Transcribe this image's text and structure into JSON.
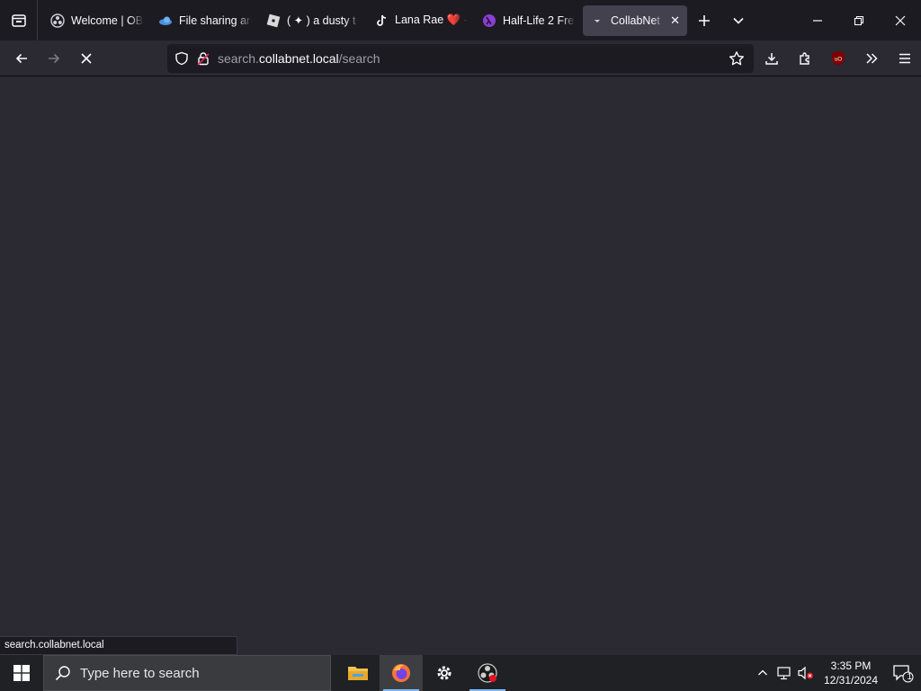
{
  "browser": {
    "tabs": [
      {
        "title": "Welcome | OB",
        "icon": "obs-icon",
        "active": false
      },
      {
        "title": "File sharing ar",
        "icon": "cloud-icon",
        "active": false
      },
      {
        "title": "( ✦ ) a dusty t",
        "icon": "roblox-icon",
        "active": false
      },
      {
        "title": "Lana Rae ❤️ -",
        "icon": "tiktok-icon",
        "active": false
      },
      {
        "title": "Half-Life 2 Fre",
        "icon": "half-life-icon",
        "active": false
      },
      {
        "title": "CollabNet S",
        "icon": "collabnet-icon",
        "active": true
      }
    ],
    "url": {
      "prefix": "search.",
      "host": "collabnet.local",
      "path": "/search"
    },
    "status_text": "search.collabnet.local",
    "colors": {
      "chrome_dark": "#1c1b22",
      "chrome": "#2b2a33",
      "active_tab": "#42414d"
    }
  },
  "taskbar": {
    "search_placeholder": "Type here to search",
    "time": "3:35 PM",
    "date": "12/31/2024",
    "notification_count": "1",
    "apps": [
      {
        "name": "file-explorer",
        "active": false
      },
      {
        "name": "firefox",
        "active": true
      },
      {
        "name": "settings",
        "active": false
      },
      {
        "name": "obs-studio",
        "active": false
      }
    ]
  }
}
